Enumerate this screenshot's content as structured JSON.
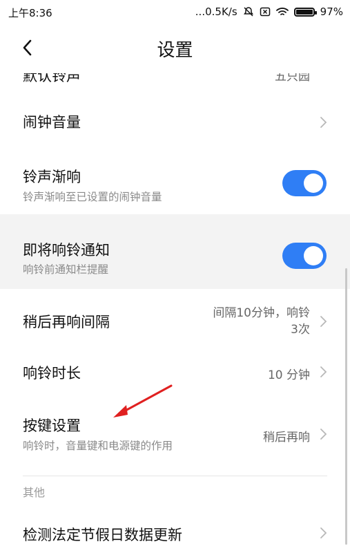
{
  "status": {
    "time": "上午8:36",
    "network_speed": "...0.5K/s",
    "battery": "97%",
    "icons": [
      "alarm-off-icon",
      "sim-error-icon",
      "wifi-icon",
      "battery-icon"
    ]
  },
  "header": {
    "title": "设置",
    "back_icon": "chevron-left-icon"
  },
  "settings": {
    "partial_top": {
      "title": "默认铃声",
      "value": "五只园"
    },
    "alarm_volume": {
      "title": "闹钟音量"
    },
    "fade_in": {
      "title": "铃声渐响",
      "subtitle": "铃声渐响至已设置的闹钟音量",
      "enabled": true
    },
    "upcoming_notify": {
      "title": "即将响铃通知",
      "subtitle": "响铃前通知栏提醒",
      "enabled": true
    },
    "snooze_interval": {
      "title": "稍后再响间隔",
      "value_line1": "间隔10分钟，响铃",
      "value_line2": "3次"
    },
    "ring_duration": {
      "title": "响铃时长",
      "value": "10 分钟"
    },
    "key_settings": {
      "title": "按键设置",
      "subtitle": "响铃时，音量键和电源键的作用",
      "value": "稍后再响"
    },
    "section_other": "其他",
    "holiday_update": {
      "title": "检测法定节假日数据更新"
    }
  },
  "colors": {
    "accent": "#2f7ef5",
    "annotation": "#e02020",
    "shade": "#f3f3f3"
  }
}
